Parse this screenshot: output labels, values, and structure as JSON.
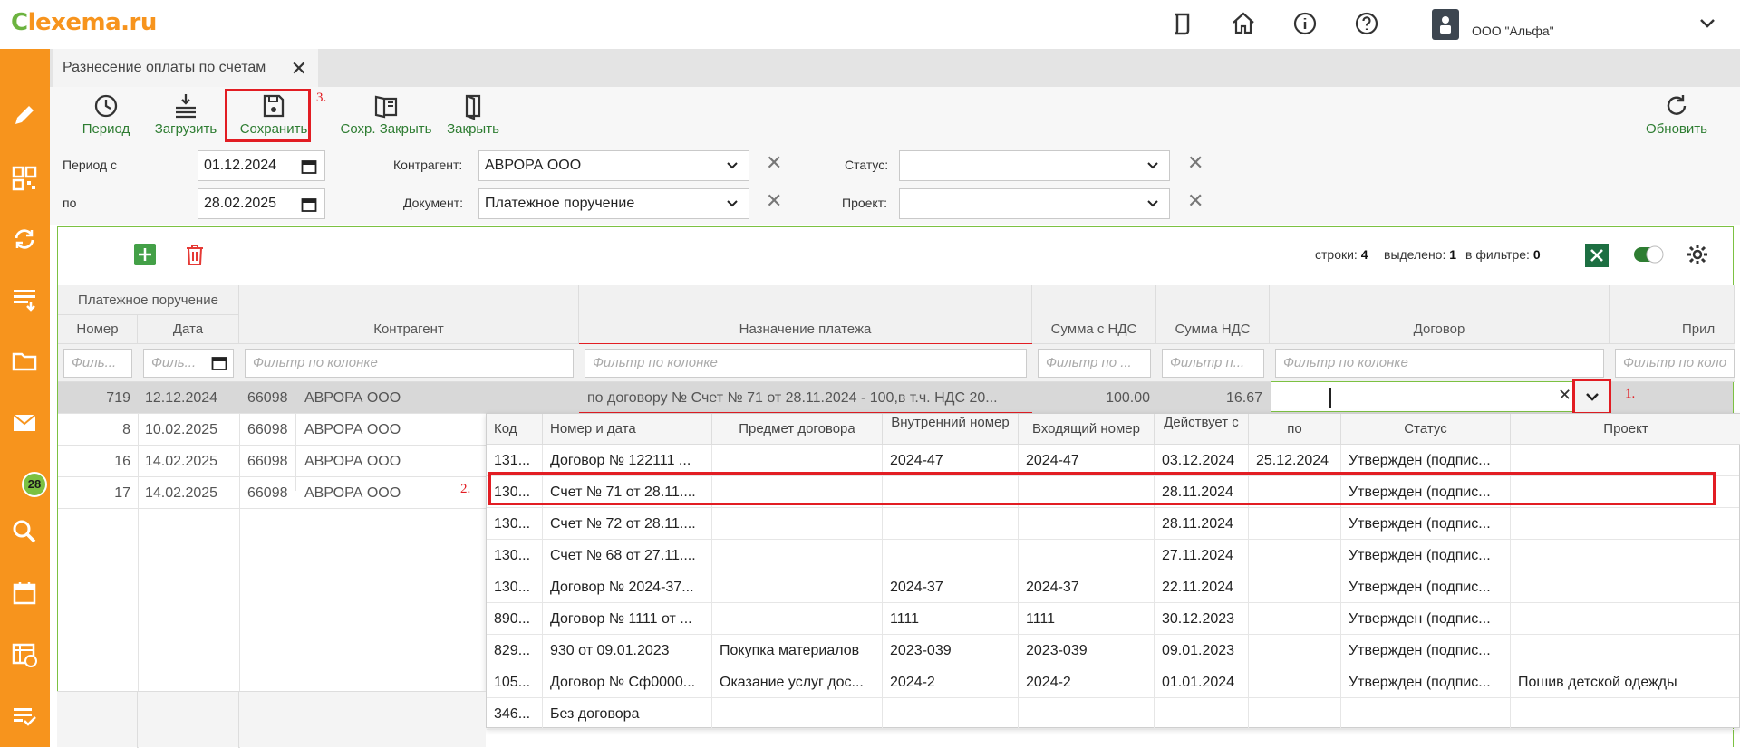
{
  "app": {
    "logo_prefix": "",
    "logo_text": "lexema.ru",
    "company": "ООО \"Альфа\""
  },
  "sidebar": {
    "mail_badge": "28"
  },
  "tab": {
    "title": "Разнесение оплаты по счетам"
  },
  "toolbar": {
    "period": "Период",
    "load": "Загрузить",
    "save": "Сохранить",
    "save_close": "Сохр. Закрыть",
    "close": "Закрыть",
    "refresh": "Обновить"
  },
  "annotations": {
    "n1": "1.",
    "n2": "2.",
    "n3": "3."
  },
  "filters": {
    "period_from_label": "Период с",
    "period_from": "01.12.2024",
    "period_to_label": "по",
    "period_to": "28.02.2025",
    "contractor_label": "Контрагент:",
    "contractor": "АВРОРА ООО",
    "document_label": "Документ:",
    "document": "Платежное поручение",
    "status_label": "Статус:",
    "status": "",
    "project_label": "Проект:",
    "project": ""
  },
  "grid": {
    "stats": {
      "rows_label": "строки:",
      "rows": "4",
      "selected_label": "выделено:",
      "selected": "1",
      "filter_label": "в фильтре:",
      "filter": "0"
    },
    "group_header": "Платежное поручение",
    "columns": {
      "number": "Номер",
      "date": "Дата",
      "contractor": "Контрагент",
      "purpose": "Назначение платежа",
      "sum_vat": "Сумма с НДС",
      "vat": "Сумма НДС",
      "contract": "Договор",
      "note": "Прил"
    },
    "filter_placeholders": {
      "number": "Филь...",
      "date": "Филь...",
      "contractor": "Фильтр по колонке",
      "purpose": "Фильтр по колонке",
      "sum_vat": "Фильтр по ...",
      "vat": "Фильтр п...",
      "contract": "Фильтр по колонке",
      "note": "Фильтр по коло"
    },
    "rows": [
      {
        "number": "719",
        "date": "12.12.2024",
        "code": "66098",
        "name": "АВРОРА ООО",
        "purpose": "по договору № Счет № 71 от 28.11.2024 - 100,в т.ч. НДС 20...",
        "sum_vat": "100.00",
        "vat": "16.67"
      },
      {
        "number": "8",
        "date": "10.02.2025",
        "code": "66098",
        "name": "АВРОРА ООО"
      },
      {
        "number": "16",
        "date": "14.02.2025",
        "code": "66098",
        "name": "АВРОРА ООО"
      },
      {
        "number": "17",
        "date": "14.02.2025",
        "code": "66098",
        "name": "АВРОРА ООО"
      }
    ]
  },
  "dropdown": {
    "columns": {
      "code": "Код",
      "number_date": "Номер и дата",
      "subject": "Предмет договора",
      "internal": "Внутренний номер",
      "incoming": "Входящий номер",
      "valid_from": "Действует с",
      "valid_to": "по",
      "status": "Статус",
      "project": "Проект"
    },
    "rows": [
      {
        "code": "131...",
        "number_date": "Договор № 122111 ...",
        "subject": "",
        "internal": "2024-47",
        "incoming": "2024-47",
        "valid_from": "03.12.2024",
        "valid_to": "25.12.2024",
        "status": "Утвержден (подпис...",
        "project": ""
      },
      {
        "code": "130...",
        "number_date": "Счет № 71 от 28.11....",
        "subject": "",
        "internal": "",
        "incoming": "",
        "valid_from": "28.11.2024",
        "valid_to": "",
        "status": "Утвержден (подпис...",
        "project": ""
      },
      {
        "code": "130...",
        "number_date": "Счет № 72 от 28.11....",
        "subject": "",
        "internal": "",
        "incoming": "",
        "valid_from": "28.11.2024",
        "valid_to": "",
        "status": "Утвержден (подпис...",
        "project": ""
      },
      {
        "code": "130...",
        "number_date": "Счет № 68 от 27.11....",
        "subject": "",
        "internal": "",
        "incoming": "",
        "valid_from": "27.11.2024",
        "valid_to": "",
        "status": "Утвержден (подпис...",
        "project": ""
      },
      {
        "code": "130...",
        "number_date": "Договор № 2024-37...",
        "subject": "",
        "internal": "2024-37",
        "incoming": "2024-37",
        "valid_from": "22.11.2024",
        "valid_to": "",
        "status": "Утвержден (подпис...",
        "project": ""
      },
      {
        "code": "890...",
        "number_date": "Договор № 1111 от ...",
        "subject": "",
        "internal": "1111",
        "incoming": "1111",
        "valid_from": "30.12.2023",
        "valid_to": "",
        "status": "Утвержден (подпис...",
        "project": ""
      },
      {
        "code": "829...",
        "number_date": "930 от 09.01.2023",
        "subject": "Покупка материалов",
        "internal": "2023-039",
        "incoming": "2023-039",
        "valid_from": "09.01.2023",
        "valid_to": "",
        "status": "Утвержден (подпис...",
        "project": ""
      },
      {
        "code": "105...",
        "number_date": "Договор № Сф0000...",
        "subject": "Оказание услуг дос...",
        "internal": "2024-2",
        "incoming": "2024-2",
        "valid_from": "01.01.2024",
        "valid_to": "",
        "status": "Утвержден (подпис...",
        "project": "Пошив детской одежды"
      },
      {
        "code": "346...",
        "number_date": "Без договора",
        "subject": "",
        "internal": "",
        "incoming": "",
        "valid_from": "",
        "valid_to": "",
        "status": "",
        "project": ""
      }
    ]
  },
  "colors": {
    "accent": "#f7941d",
    "green": "#2e7d32",
    "highlight": "#e21d23"
  }
}
